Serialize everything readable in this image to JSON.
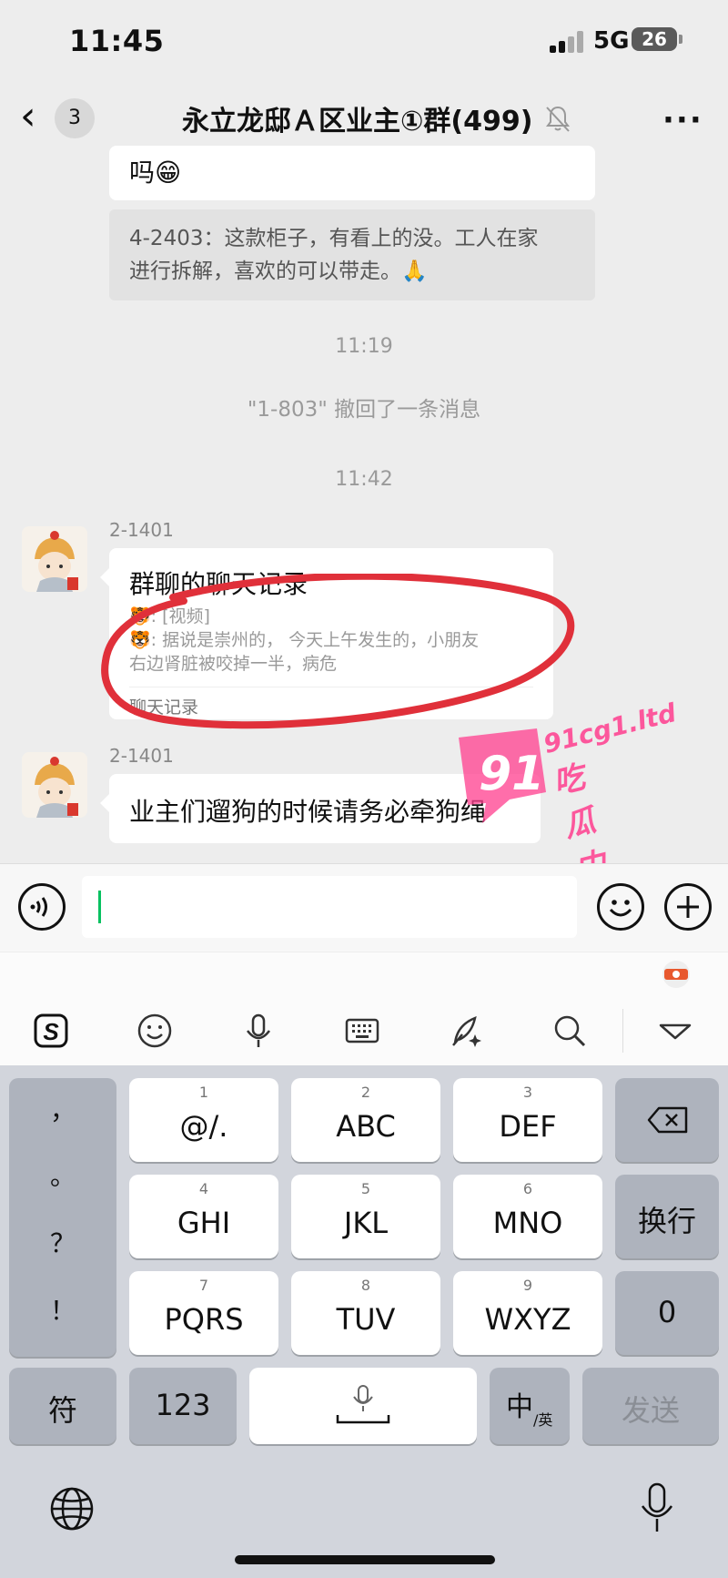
{
  "status_bar": {
    "time": "11:45",
    "network": "5G",
    "battery": "26"
  },
  "nav": {
    "back_count": "3",
    "title": "永立龙邸Ａ区业主①群(499)"
  },
  "chat": {
    "prev_bubble_text": "吗😁",
    "quote_text": [
      "4-2403：这款柜子，有看上的没。工人在家",
      "进行拆解，喜欢的可以带走。🙏"
    ],
    "time1": "11:19",
    "recall_notice": "\"1-803\" 撤回了一条消息",
    "time2": "11:42",
    "msg1": {
      "sender": "2-1401",
      "title": "群聊的聊天记录",
      "lines": [
        "🐯: [视频]",
        "🐯: 据说是崇州的， 今天上午发生的，小朋友",
        "右边肾脏被咬掉一半，病危"
      ],
      "footer": "聊天记录"
    },
    "msg2": {
      "sender": "2-1401",
      "text": "业主们遛狗的时候请务必牵狗绳"
    }
  },
  "watermark": {
    "number": "91",
    "domain": "91cg1.ltd",
    "name": "吃瓜中心"
  },
  "keyboard": {
    "punct": [
      "，",
      "。",
      "？",
      "！"
    ],
    "rows": [
      [
        {
          "num": "1",
          "label": "@/."
        },
        {
          "num": "2",
          "label": "ABC"
        },
        {
          "num": "3",
          "label": "DEF"
        }
      ],
      [
        {
          "num": "4",
          "label": "GHI"
        },
        {
          "num": "5",
          "label": "JKL"
        },
        {
          "num": "6",
          "label": "MNO"
        }
      ],
      [
        {
          "num": "7",
          "label": "PQRS"
        },
        {
          "num": "8",
          "label": "TUV"
        },
        {
          "num": "9",
          "label": "WXYZ"
        }
      ]
    ],
    "newline": "换行",
    "zero": "0",
    "symbols": "符",
    "num_mode": "123",
    "lang_main": "中",
    "lang_sub": "/英",
    "send": "发送"
  },
  "colors": {
    "accent_green": "#07c160",
    "circle_red": "#e0303a",
    "watermark_pink": "#ff3d8e"
  }
}
